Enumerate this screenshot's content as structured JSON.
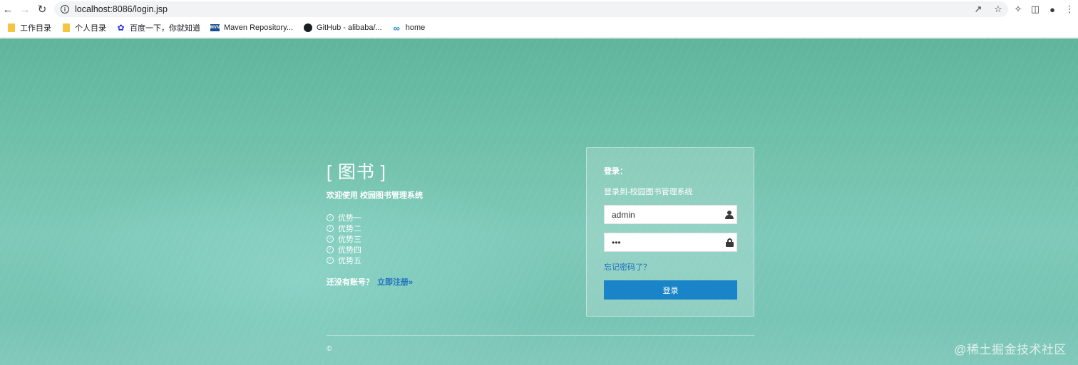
{
  "browser": {
    "url_host": "localhost:8086",
    "url_path": "/login.jsp",
    "bookmarks": [
      {
        "label": "工作目录",
        "icon": "folder-icon"
      },
      {
        "label": "个人目录",
        "icon": "folder-icon"
      },
      {
        "label": "百度一下，你就知道",
        "icon": "baidu-paw-icon"
      },
      {
        "label": "Maven Repository...",
        "icon": "maven-icon"
      },
      {
        "label": "GitHub - alibaba/...",
        "icon": "github-icon"
      },
      {
        "label": "home",
        "icon": "infinity-icon"
      }
    ]
  },
  "intro": {
    "brand": "[ 图书 ]",
    "welcome": "欢迎使用 校园图书管理系统",
    "features": [
      "优势一",
      "优势二",
      "优势三",
      "优势四",
      "优势五"
    ],
    "no_account": "还没有账号？",
    "register_link": "立即注册»"
  },
  "login": {
    "title": "登录：",
    "subtitle": "登录到-校园图书管理系统",
    "username_value": "admin",
    "password_value": "•••",
    "forgot_link": "忘记密码了？",
    "submit_label": "登录"
  },
  "footer": {
    "copyright": "©"
  },
  "watermark": "@稀土掘金技术社区",
  "colors": {
    "accent": "#1a84c8",
    "link": "#1e6fbf",
    "background": "#6fc0a8"
  }
}
